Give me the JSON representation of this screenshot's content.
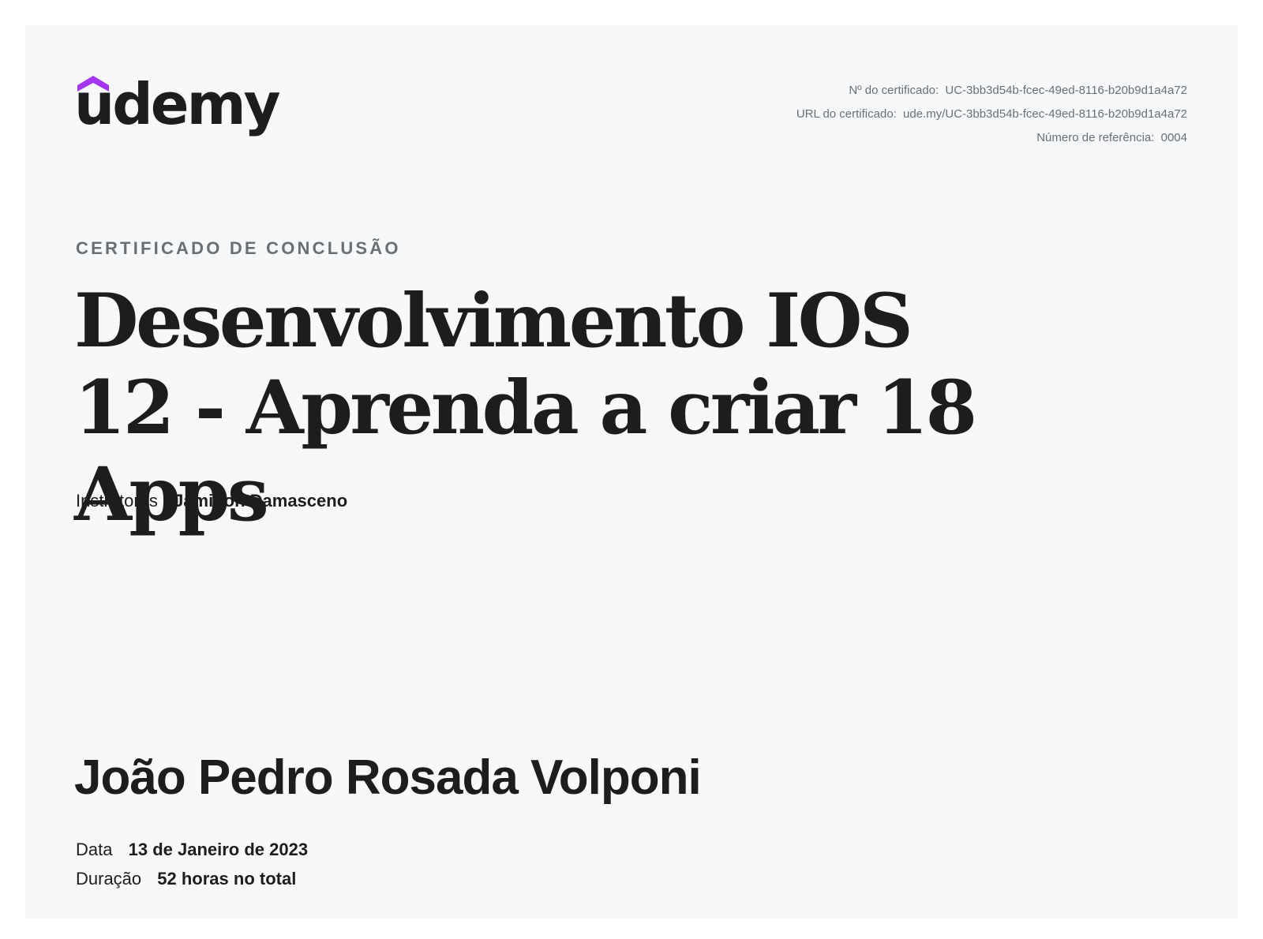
{
  "brand": {
    "logo_text": "udemy",
    "logo_icon": "udemy-hat-icon",
    "accent_color": "#a435f0"
  },
  "meta": {
    "cert_number_label": "Nº do certificado:",
    "cert_number": "UC-3bb3d54b-fcec-49ed-8116-b20b9d1a4a72",
    "cert_url_label": "URL do certificado:",
    "cert_url": "ude.my/UC-3bb3d54b-fcec-49ed-8116-b20b9d1a4a72",
    "reference_label": "Número de referência:",
    "reference": "0004"
  },
  "certificate": {
    "eyebrow": "CERTIFICADO DE CONCLUSÃO",
    "course_title": "Desenvolvimento IOS 12 - Aprenda a criar 18 Apps",
    "instructors_label": "Instrutores",
    "instructors": "Jamilton Damasceno",
    "student_name": "João Pedro Rosada Volponi",
    "date_label": "Data",
    "date": "13 de Janeiro de 2023",
    "duration_label": "Duração",
    "duration": "52 horas no total"
  }
}
